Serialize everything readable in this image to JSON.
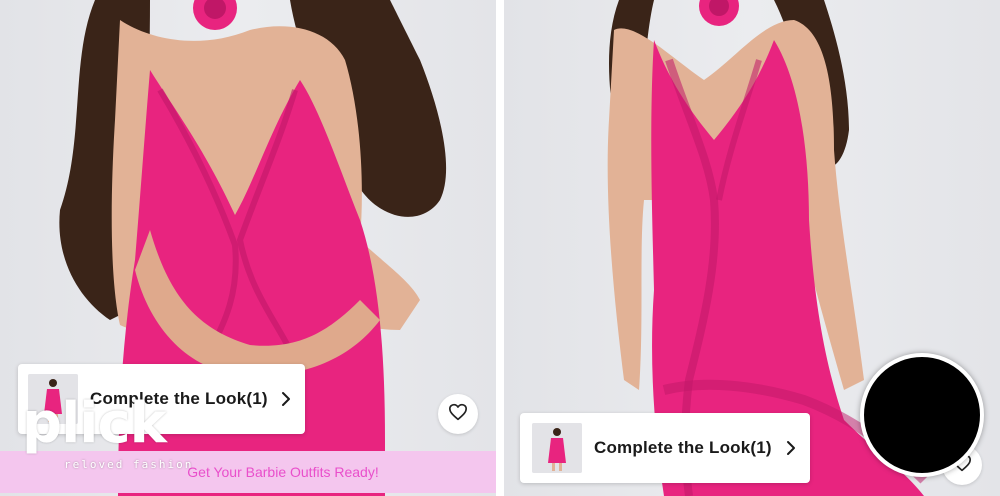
{
  "colors": {
    "dress": "#e8247f",
    "promo_bg": "#f4c6ee",
    "promo_text": "#e94fcb",
    "card_bg": "#ffffff",
    "overlay_dot": "#000000"
  },
  "gallery": [
    {
      "complete_look": {
        "label": "Complete the Look(1)",
        "icon": "chevron-right-icon"
      },
      "favorite_icon": "heart-outline-icon"
    },
    {
      "complete_look": {
        "label": "Complete the Look(1)",
        "icon": "chevron-right-icon"
      },
      "favorite_icon": "heart-outline-icon"
    }
  ],
  "promo": {
    "text": "Get Your Barbie Outfits Ready!"
  },
  "brand": {
    "logo_text": "plick",
    "tagline": "reloved fashion"
  }
}
